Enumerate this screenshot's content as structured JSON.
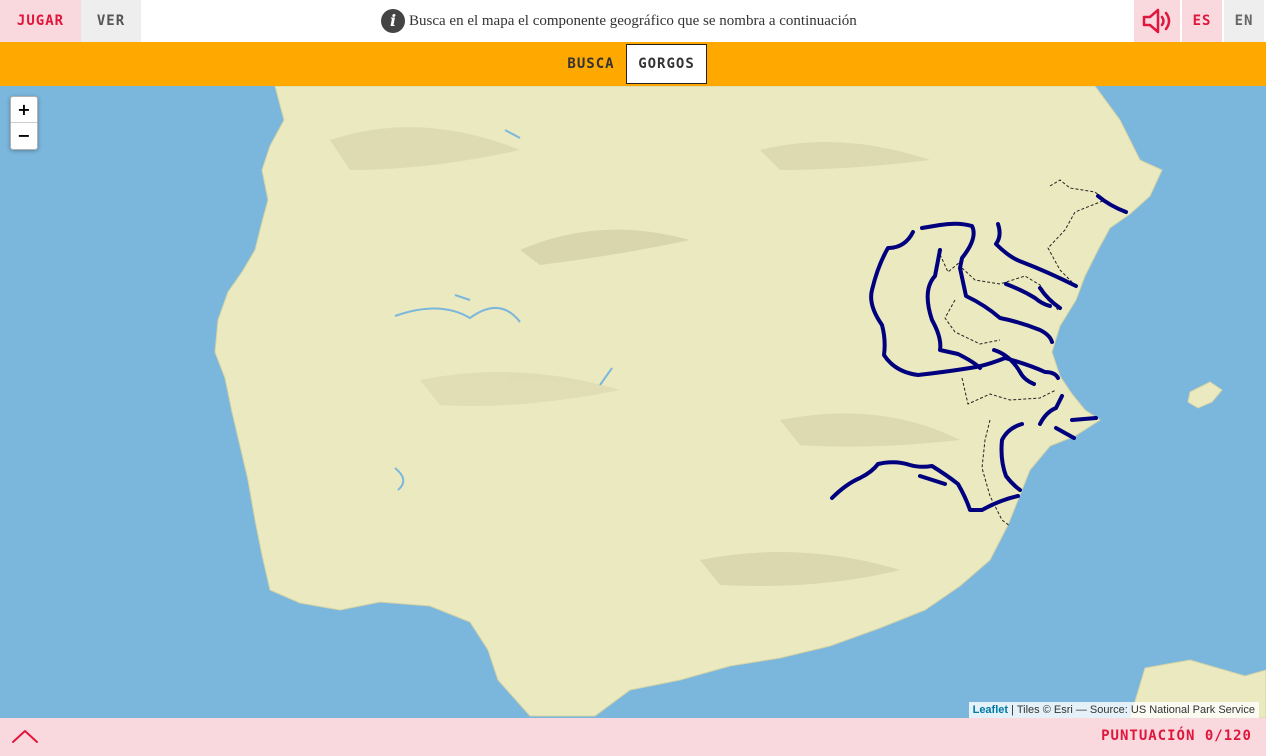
{
  "header": {
    "tabs": [
      {
        "label": "JUGAR",
        "active": true
      },
      {
        "label": "VER",
        "active": false
      }
    ],
    "instruction": "Busca en el mapa el componente geográfico que se nombra a continuación",
    "info_icon": "info-icon",
    "sound_icon": "speaker-icon",
    "languages": [
      {
        "label": "ES",
        "active": true
      },
      {
        "label": "EN",
        "active": false
      }
    ]
  },
  "search": {
    "label": "BUSCA",
    "target": "GORGOS"
  },
  "map": {
    "zoom_in": "+",
    "zoom_out": "−",
    "attribution_link": "Leaflet",
    "attribution_text": " | Tiles © Esri — Source: US National Park Service",
    "colors": {
      "sea": "#7bb7dd",
      "land": "#ebe9bf",
      "rivers": "#00007f",
      "accent": "#ffa800"
    }
  },
  "footer": {
    "expand_icon": "chevron-up-icon",
    "score_label": "PUNTUACIÓN",
    "score_value": "0/120"
  }
}
